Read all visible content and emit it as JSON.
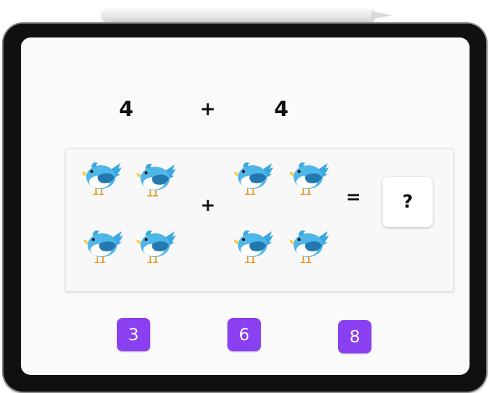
{
  "equation": {
    "left_number": "4",
    "operator": "+",
    "right_number": "4"
  },
  "visual": {
    "left_bird_count": 4,
    "right_bird_count": 4,
    "operator": "+",
    "equals": "=",
    "answer_placeholder": "?",
    "bird_icon": "bird-icon"
  },
  "choices": [
    {
      "label": "3"
    },
    {
      "label": "6"
    },
    {
      "label": "8"
    }
  ],
  "colors": {
    "choice_bg": "#8a3ff0",
    "bird_body": "#3aa8e0",
    "bird_wing": "#2378b0",
    "bird_beak": "#f2c12e",
    "bird_legs": "#e8a33a"
  }
}
